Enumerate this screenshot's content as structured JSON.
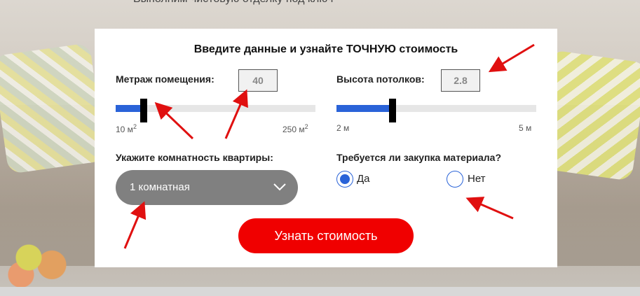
{
  "background": {
    "caption": "Выполним чистовую отделку под ключ"
  },
  "form": {
    "title": "Введите данные и узнайте ТОЧНУЮ стоимость",
    "area": {
      "label": "Метраж помещения:",
      "value": "40",
      "min_label": "10 м",
      "min_unit_sup": "2",
      "max_label": "250 м",
      "max_unit_sup": "2",
      "min": 10,
      "max": 250,
      "current": 40
    },
    "ceiling": {
      "label": "Высота потолков:",
      "value": "2.8",
      "min_label": "2 м",
      "max_label": "5 м",
      "min": 2,
      "max": 5,
      "current": 2.8
    },
    "rooms": {
      "label": "Укажите комнатность квартиры:",
      "selected": "1 комнатная"
    },
    "materials": {
      "label": "Требуется ли закупка материала?",
      "options": [
        {
          "label": "Да",
          "checked": true
        },
        {
          "label": "Нет",
          "checked": false
        }
      ]
    },
    "submit_label": "Узнать стоимость"
  },
  "colors": {
    "accent_blue": "#2a63d8",
    "cta_red": "#f00000",
    "select_gray": "#808080",
    "annotation_red": "#e01010"
  }
}
